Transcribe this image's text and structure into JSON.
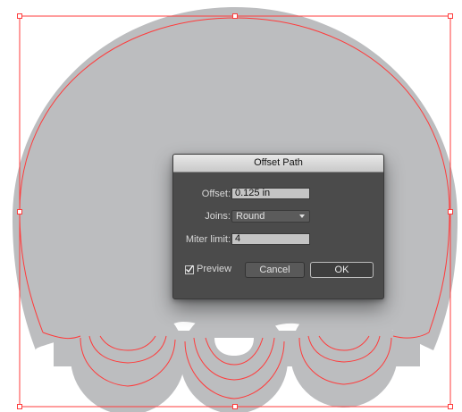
{
  "dialog": {
    "title": "Offset Path",
    "offset_label": "Offset:",
    "offset_value": "0.125 in",
    "joins_label": "Joins:",
    "joins_value": "Round",
    "miter_label": "Miter limit:",
    "miter_value": "4",
    "preview_label": "Preview",
    "preview_checked": true,
    "cancel_label": "Cancel",
    "ok_label": "OK"
  },
  "colors": {
    "selection": "#ff3b3b",
    "shape_fill": "#bcbdbf",
    "dialog_bg": "#4b4b4b",
    "title_bar": "#d8d8d8"
  }
}
